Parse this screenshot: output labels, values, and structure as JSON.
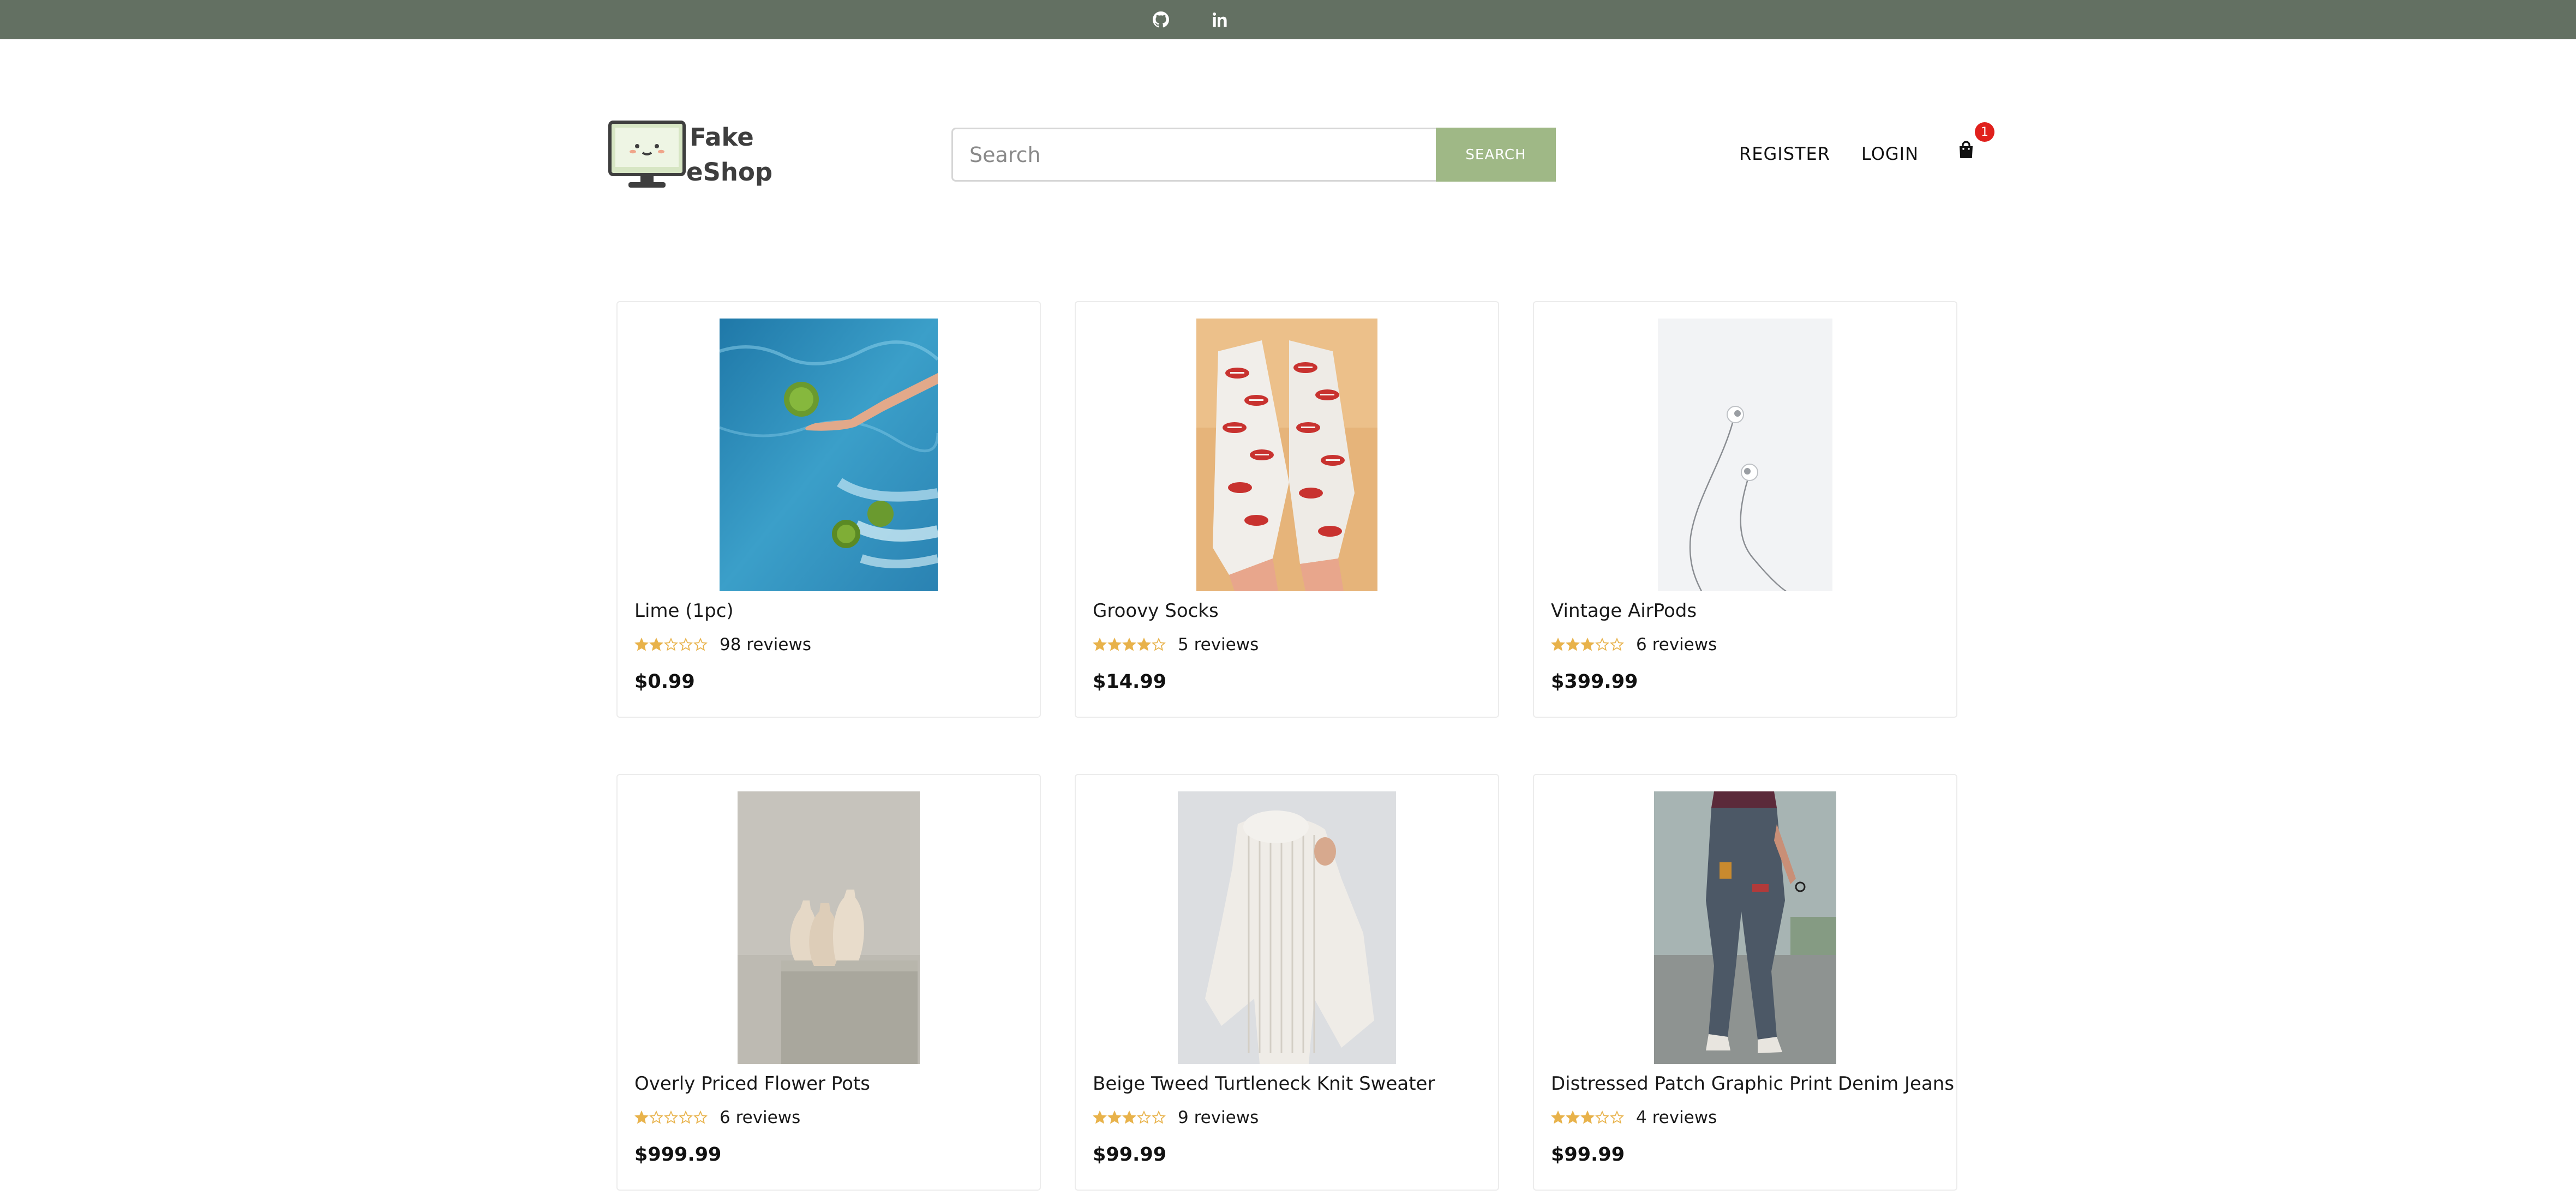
{
  "topbar": {
    "links": [
      {
        "icon": "github-icon",
        "label": "GitHub"
      },
      {
        "icon": "linkedin-icon",
        "label": "LinkedIn"
      }
    ]
  },
  "header": {
    "logo_line1": "Fake",
    "logo_line2": "eShop",
    "search_placeholder": "Search",
    "search_button": "SEARCH",
    "register": "REGISTER",
    "login": "LOGIN",
    "cart_count": "1"
  },
  "colors": {
    "topbar": "#637062",
    "accent": "#9fb886",
    "star": "#e8b24a",
    "badge": "#e0201c"
  },
  "products": [
    {
      "name": "Lime (1pc)",
      "rating": 2,
      "reviews": "98 reviews",
      "price": "$0.99",
      "image": "lime-photo"
    },
    {
      "name": "Groovy Socks",
      "rating": 4,
      "reviews": "5 reviews",
      "price": "$14.99",
      "image": "socks-photo"
    },
    {
      "name": "Vintage AirPods",
      "rating": 3,
      "reviews": "6 reviews",
      "price": "$399.99",
      "image": "airpods-photo"
    },
    {
      "name": "Overly Priced Flower Pots",
      "rating": 1,
      "reviews": "6 reviews",
      "price": "$999.99",
      "image": "flower-pots-photo"
    },
    {
      "name": "Beige Tweed Turtleneck Knit Sweater",
      "rating": 3,
      "reviews": "9 reviews",
      "price": "$99.99",
      "image": "sweater-photo"
    },
    {
      "name": "Distressed Patch Graphic Print Denim Jeans",
      "rating": 3,
      "reviews": "4 reviews",
      "price": "$99.99",
      "image": "jeans-photo"
    }
  ]
}
